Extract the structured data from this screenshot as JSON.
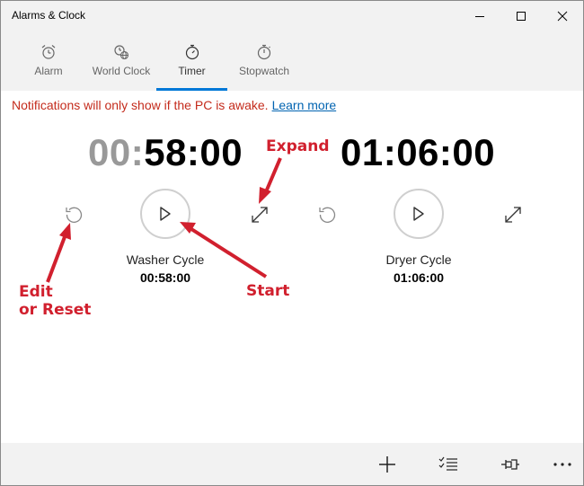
{
  "app": {
    "title": "Alarms & Clock"
  },
  "tabs": [
    {
      "label": "Alarm",
      "icon": "alarm-icon"
    },
    {
      "label": "World Clock",
      "icon": "world-clock-icon"
    },
    {
      "label": "Timer",
      "icon": "timer-icon",
      "active": true
    },
    {
      "label": "Stopwatch",
      "icon": "stopwatch-icon"
    }
  ],
  "notice": {
    "text": "Notifications will only show if the PC is awake.",
    "link": "Learn more"
  },
  "timers": [
    {
      "big_prefix": "00",
      "big_colon": ":",
      "big_rest": "58:00",
      "name": "Washer Cycle",
      "time": "00:58:00"
    },
    {
      "big_full": "01:06:00",
      "name": "Dryer Cycle",
      "time": "01:06:00"
    }
  ],
  "annotations": {
    "expand": "Expand",
    "start": "Start",
    "edit_line1": "Edit",
    "edit_line2": "or Reset"
  },
  "colors": {
    "accent": "#0078d7",
    "annotation": "#d1202e",
    "notice": "#c42b1c",
    "link": "#0063b1"
  },
  "command_bar": [
    "add-icon",
    "edit-list-icon",
    "pin-icon",
    "more-icon"
  ]
}
